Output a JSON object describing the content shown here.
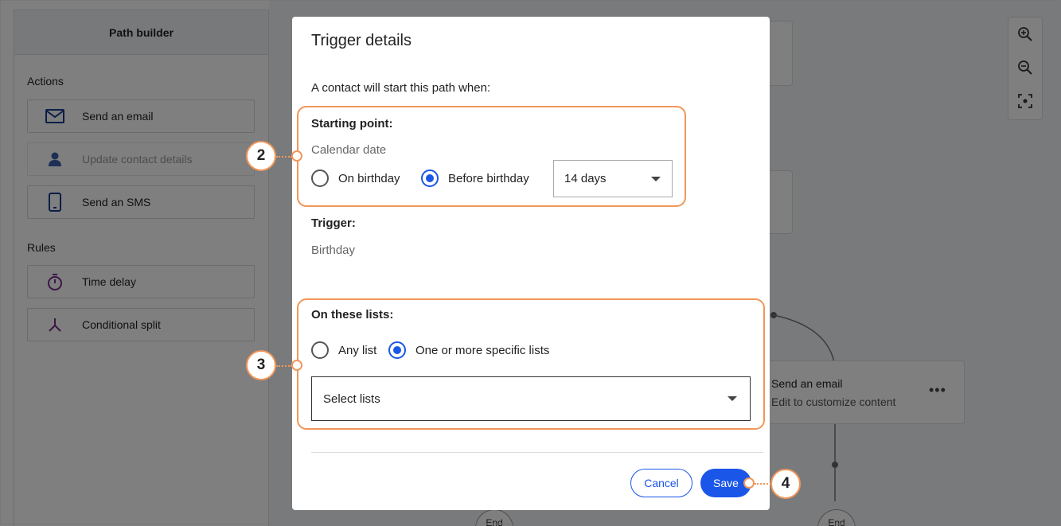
{
  "sidebar": {
    "title": "Path builder",
    "actions_label": "Actions",
    "rules_label": "Rules",
    "items": [
      {
        "label": "Send an email",
        "icon": "envelope-icon"
      },
      {
        "label": "Update contact details",
        "icon": "person-icon"
      },
      {
        "label": "Send an SMS",
        "icon": "phone-icon"
      },
      {
        "label": "Time delay",
        "icon": "stopwatch-icon"
      },
      {
        "label": "Conditional split",
        "icon": "split-arrows-icon"
      }
    ]
  },
  "canvas": {
    "email_node": {
      "title": "Send an email",
      "subtitle": "Edit to customize content",
      "menu": "•••"
    },
    "end_label": "End",
    "zoom": [
      "zoom-in-icon",
      "zoom-out-icon",
      "fit-to-screen-icon"
    ]
  },
  "modal": {
    "title": "Trigger details",
    "intro": "A contact will start this path when:",
    "starting_point": {
      "label": "Starting point:",
      "value": "Calendar date",
      "options": [
        "On birthday",
        "Before birthday"
      ],
      "selected": "Before birthday",
      "days": "14 days"
    },
    "trigger": {
      "label": "Trigger:",
      "value": "Birthday"
    },
    "lists": {
      "label": "On these lists:",
      "options": [
        "Any list",
        "One or more specific lists"
      ],
      "selected": "One or more specific lists",
      "placeholder": "Select lists"
    },
    "buttons": {
      "cancel": "Cancel",
      "save": "Save"
    }
  },
  "callouts": [
    "2",
    "3",
    "4"
  ],
  "colors": {
    "accent": "#1a56e8",
    "highlight": "#f0975a",
    "email_icon": "#1a3a8f",
    "rule_icon": "#7b2f8f"
  }
}
